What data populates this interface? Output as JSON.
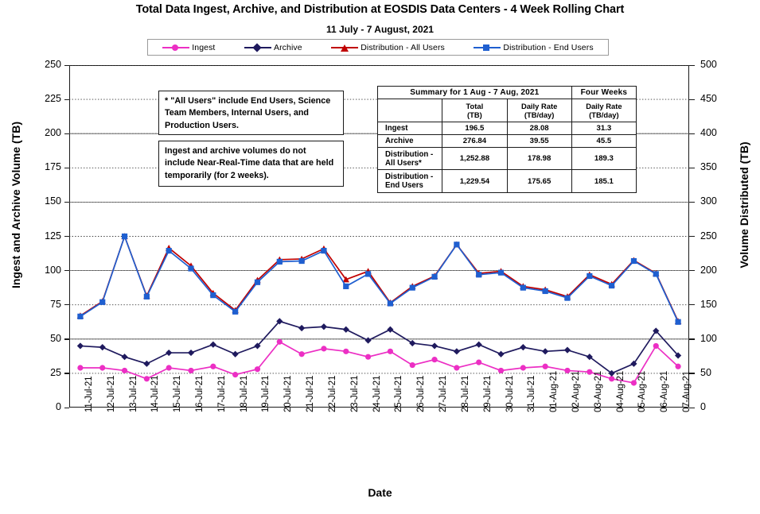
{
  "chart_data": {
    "type": "line",
    "title": "Total Data Ingest, Archive, and  Distribution at EOSDIS Data Centers - 4 Week Rolling Chart",
    "subtitle": "11 July  -  7 August,  2021",
    "xlabel": "Date",
    "ylabel": "Ingest and Archive Volume (TB)",
    "ylabel_right": "Volume Distributed (TB)",
    "ylim": [
      0,
      250
    ],
    "ylim_right": [
      0,
      500
    ],
    "yticks": [
      0,
      25,
      50,
      75,
      100,
      125,
      150,
      175,
      200,
      225,
      250
    ],
    "yticks_right": [
      0,
      50,
      100,
      150,
      200,
      250,
      300,
      350,
      400,
      450,
      500
    ],
    "grid": true,
    "legend_position": "top",
    "categories": [
      "11-Jul-21",
      "12-Jul-21",
      "13-Jul-21",
      "14-Jul-21",
      "15-Jul-21",
      "16-Jul-21",
      "17-Jul-21",
      "18-Jul-21",
      "19-Jul-21",
      "20-Jul-21",
      "21-Jul-21",
      "22-Jul-21",
      "23-Jul-21",
      "24-Jul-21",
      "25-Jul-21",
      "26-Jul-21",
      "27-Jul-21",
      "28-Jul-21",
      "29-Jul-21",
      "30-Jul-21",
      "31-Jul-21",
      "01-Aug-21",
      "02-Aug-21",
      "03-Aug-21",
      "04-Aug-21",
      "05-Aug-21",
      "06-Aug-21",
      "07-Aug-21"
    ],
    "series": [
      {
        "name": "Ingest",
        "axis": "left",
        "color": "#ec2fc4",
        "marker": "circle",
        "values": [
          29,
          29,
          27,
          21,
          29,
          27,
          30,
          24,
          28,
          48,
          39,
          43,
          41,
          37,
          41,
          31,
          35,
          29,
          33,
          27,
          29,
          30,
          27,
          26,
          21,
          18,
          45,
          30
        ]
      },
      {
        "name": "Archive",
        "axis": "left",
        "color": "#1f1a5e",
        "marker": "diamond",
        "values": [
          45,
          44,
          37,
          32,
          40,
          40,
          46,
          39,
          45,
          63,
          58,
          59,
          57,
          49,
          57,
          47,
          45,
          41,
          46,
          39,
          44,
          41,
          42,
          37,
          25,
          32,
          56,
          38
        ]
      },
      {
        "name": "Distribution - All Users",
        "axis": "right",
        "color": "#c00000",
        "marker": "triangle",
        "values": [
          134,
          155,
          250,
          163,
          233,
          207,
          167,
          142,
          186,
          216,
          217,
          232,
          187,
          199,
          153,
          177,
          192,
          238,
          196,
          199,
          177,
          172,
          162,
          194,
          180,
          215,
          196,
          126
        ]
      },
      {
        "name": "Distribution - End Users",
        "axis": "right",
        "color": "#1f5fd0",
        "marker": "square",
        "values": [
          133,
          154,
          250,
          162,
          229,
          203,
          164,
          140,
          183,
          213,
          214,
          229,
          177,
          195,
          152,
          175,
          191,
          238,
          194,
          197,
          175,
          170,
          160,
          192,
          178,
          214,
          195,
          125
        ]
      }
    ]
  },
  "legend": {
    "items": [
      {
        "label": "Ingest",
        "color": "#ec2fc4",
        "marker": "circle"
      },
      {
        "label": "Archive",
        "color": "#1f1a5e",
        "marker": "diamond"
      },
      {
        "label": "Distribution - All Users",
        "color": "#c00000",
        "marker": "triangle"
      },
      {
        "label": "Distribution - End Users",
        "color": "#1f5fd0",
        "marker": "square"
      }
    ]
  },
  "notes": {
    "all_users": "* \"All Users\" include End Users, Science Team Members,  Internal Users, and Production Users.",
    "near_real_time": "Ingest and archive volumes do not include Near-Real-Time data that are held temporarily (for 2 weeks)."
  },
  "summary": {
    "title": "Summary for  1 Aug  -  7 Aug,  2021",
    "four_weeks_header": "Four Weeks",
    "columns": [
      "Total (TB)",
      "Daily Rate (TB/day)",
      "Daily Rate (TB/day)"
    ],
    "col_total_l1": "Total",
    "col_total_l2": "(TB)",
    "col_rate_l1": "Daily Rate",
    "col_rate_l2": "(TB/day)",
    "col_fw_rate_l1": "Daily Rate",
    "col_fw_rate_l2": "(TB/day)",
    "rows": [
      {
        "label": "Ingest",
        "total": "196.5",
        "daily_rate": "28.08",
        "four_week_daily_rate": "31.3"
      },
      {
        "label": "Archive",
        "total": "276.84",
        "daily_rate": "39.55",
        "four_week_daily_rate": "45.5"
      },
      {
        "label": "Distribution - All Users*",
        "total": "1,252.88",
        "daily_rate": "178.98",
        "four_week_daily_rate": "189.3"
      },
      {
        "label": "Distribution - End Users",
        "total": "1,229.54",
        "daily_rate": "175.65",
        "four_week_daily_rate": "185.1"
      }
    ]
  }
}
